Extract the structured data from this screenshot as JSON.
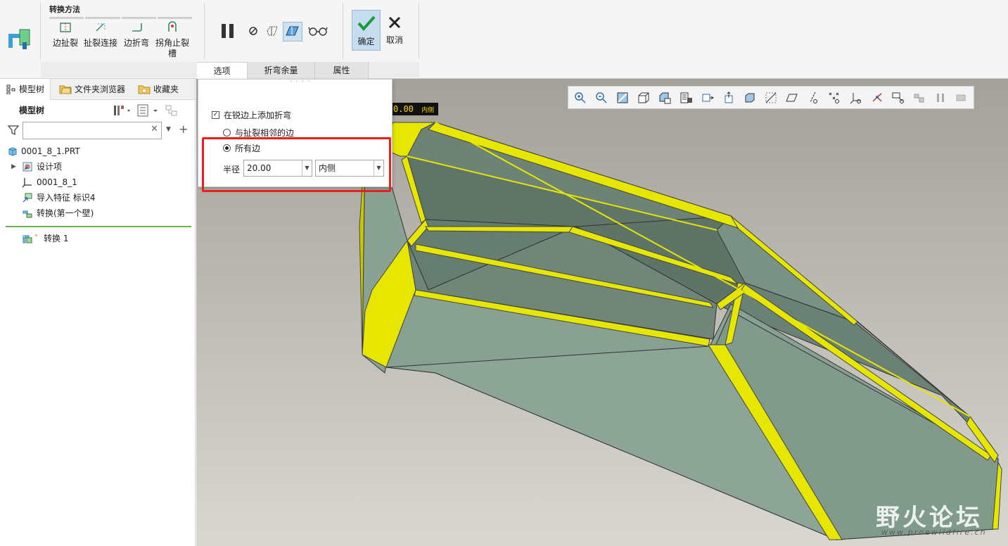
{
  "ribbon": {
    "group_title": "转换方法",
    "method_buttons": [
      {
        "label": "边扯裂"
      },
      {
        "label": "扯裂连接"
      },
      {
        "label": "边折弯"
      },
      {
        "label": "拐角止裂槽"
      }
    ],
    "ok_label": "确定",
    "cancel_label": "取消",
    "tabs": [
      {
        "label": "选项",
        "active": true
      },
      {
        "label": "折弯余量",
        "active": false
      },
      {
        "label": "属性",
        "active": false
      }
    ]
  },
  "left_panel": {
    "tabs": [
      {
        "label": "模型树",
        "icon": "tree-icon",
        "active": true
      },
      {
        "label": "文件夹浏览器",
        "icon": "folder-icon",
        "active": false
      },
      {
        "label": "收藏夹",
        "icon": "favorites-icon",
        "active": false
      }
    ],
    "tree_title": "模型树",
    "search": {
      "value": "",
      "placeholder": ""
    },
    "tree": [
      {
        "label": "0001_8_1.PRT",
        "icon": "part-icon"
      },
      {
        "label": "设计项",
        "icon": "design-items-icon"
      },
      {
        "label": "0001_8_1",
        "icon": "coord-system-icon"
      },
      {
        "label": "导入特征 标识4",
        "icon": "import-feature-icon"
      },
      {
        "label": "转换(第一个壁)",
        "icon": "convert-icon"
      },
      {
        "label": "转换 1",
        "icon": "convert-active-icon"
      }
    ]
  },
  "options_panel": {
    "add_bend_label": "在锐边上添加折弯",
    "add_bend_checked": true,
    "radio_adjacent_label": "与扯裂相邻的边",
    "radio_all_label": "所有边",
    "selected_radio": "all",
    "radius_label": "半径",
    "radius_value": "20.00",
    "side_value": "内侧"
  },
  "viewport": {
    "dimension_tag": "0.00",
    "dimension_side": "内侧",
    "toolbar_icons": [
      "zoom-in-icon",
      "zoom-out-icon",
      "refit-icon",
      "view-orient-icon",
      "saved-views-icon",
      "display-style-icon",
      "datum-planes-icon",
      "datum-axes-icon",
      "datum-points-icon",
      "perspective-icon",
      "plane-display-icon",
      "axis-display-icon",
      "point-display-icon",
      "csys-display-icon",
      "spin-center-icon",
      "annotation-display-icon",
      "pause-regen-icon",
      "pause-icon",
      "toggle-icon"
    ],
    "watermark_text": "野火论坛",
    "watermark_url": "www.proewildfire.cn"
  },
  "colors": {
    "accent_blue": "#c6ddf0",
    "highlight_red": "#ee1d1d",
    "bend_yellow": "#e6e600",
    "surface_green": "#7e9588"
  }
}
